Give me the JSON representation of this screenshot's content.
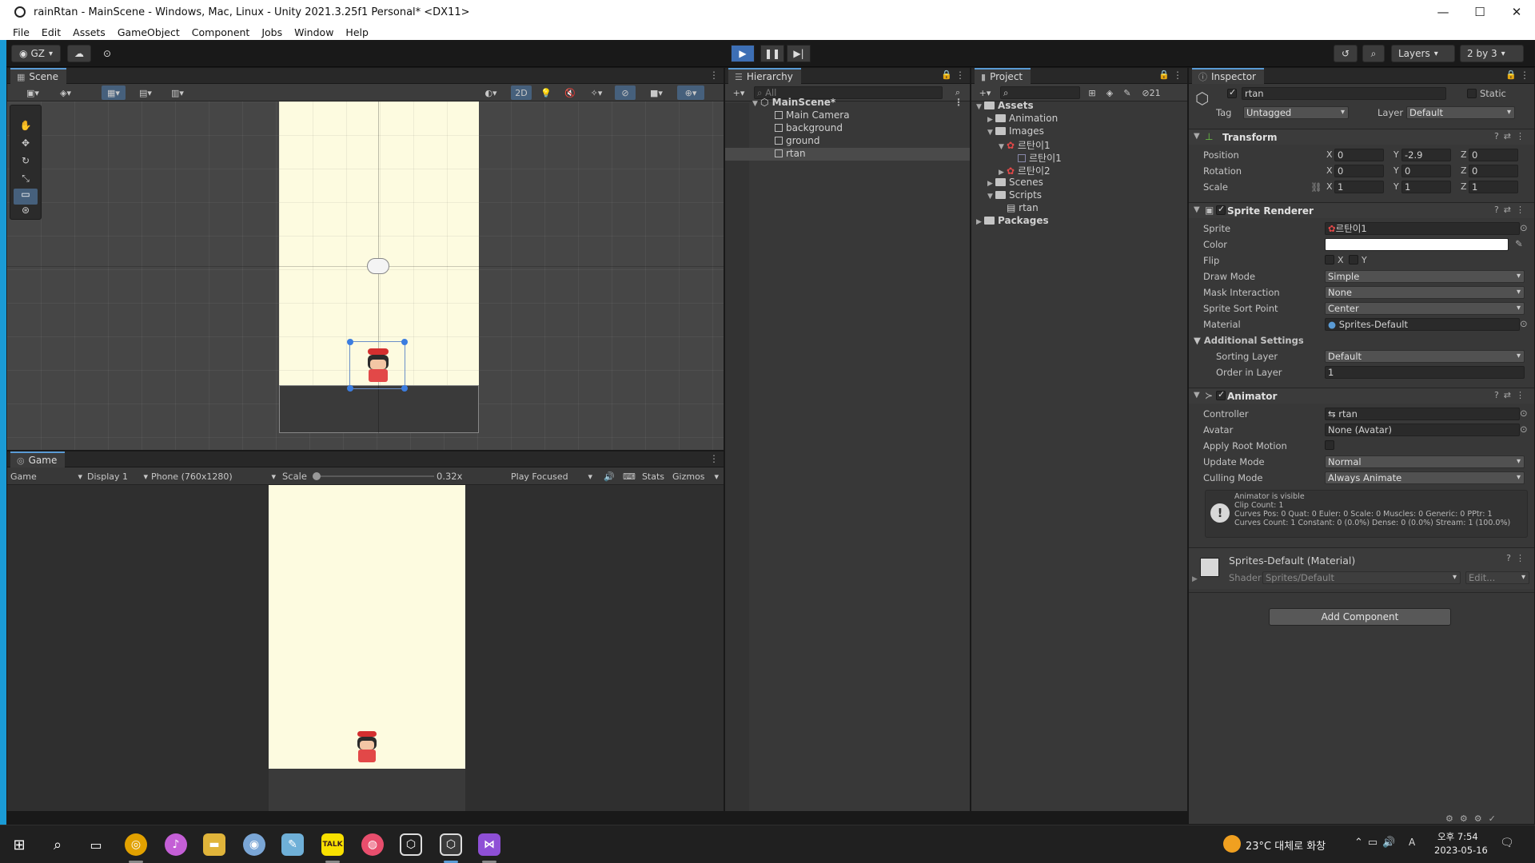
{
  "window": {
    "title": "rainRtan - MainScene - Windows, Mac, Linux - Unity 2021.3.25f1 Personal* <DX11>"
  },
  "menu": [
    "File",
    "Edit",
    "Assets",
    "GameObject",
    "Component",
    "Jobs",
    "Window",
    "Help"
  ],
  "toolbar": {
    "account": "GZ",
    "layers": "Layers",
    "layout": "2 by 3"
  },
  "scene": {
    "tab": "Scene",
    "mode_2d": "2D"
  },
  "game": {
    "tab": "Game",
    "view": "Game",
    "display": "Display 1",
    "resolution": "Phone (760x1280)",
    "scale_label": "Scale",
    "scale_value": "0.32x",
    "play_mode": "Play Focused",
    "stats": "Stats",
    "gizmos": "Gizmos"
  },
  "hierarchy": {
    "tab": "Hierarchy",
    "search_placeholder": "All",
    "scene_name": "MainScene*",
    "items": [
      "Main Camera",
      "background",
      "ground",
      "rtan"
    ]
  },
  "project": {
    "tab": "Project",
    "count": "21",
    "tree": {
      "assets": "Assets",
      "animation": "Animation",
      "images": "Images",
      "img1": "르탄이1",
      "img1_sub": "르탄이1",
      "img2": "르탄이2",
      "scenes": "Scenes",
      "scripts": "Scripts",
      "script_rtan": "rtan",
      "packages": "Packages"
    }
  },
  "inspector": {
    "tab": "Inspector",
    "object_name": "rtan",
    "static_label": "Static",
    "tag_label": "Tag",
    "tag_value": "Untagged",
    "layer_label": "Layer",
    "layer_value": "Default",
    "transform": {
      "title": "Transform",
      "position_label": "Position",
      "rotation_label": "Rotation",
      "scale_label": "Scale",
      "x": "X",
      "y": "Y",
      "z": "Z",
      "position": [
        "0",
        "-2.9",
        "0"
      ],
      "rotation": [
        "0",
        "0",
        "0"
      ],
      "scale": [
        "1",
        "1",
        "1"
      ]
    },
    "sprite_renderer": {
      "title": "Sprite Renderer",
      "sprite_label": "Sprite",
      "sprite": "르탄이1",
      "color_label": "Color",
      "color": "#ffffff",
      "flip_label": "Flip",
      "flip_x": "X",
      "flip_y": "Y",
      "draw_mode_label": "Draw Mode",
      "draw_mode": "Simple",
      "mask_label": "Mask Interaction",
      "mask": "None",
      "sort_point_label": "Sprite Sort Point",
      "sort_point": "Center",
      "material_label": "Material",
      "material": "Sprites-Default",
      "additional_label": "Additional Settings",
      "sorting_layer_label": "Sorting Layer",
      "sorting_layer": "Default",
      "order_label": "Order in Layer",
      "order": "1"
    },
    "animator": {
      "title": "Animator",
      "controller_label": "Controller",
      "controller": "rtan",
      "avatar_label": "Avatar",
      "avatar": "None (Avatar)",
      "root_motion_label": "Apply Root Motion",
      "update_mode_label": "Update Mode",
      "update_mode": "Normal",
      "culling_label": "Culling Mode",
      "culling": "Always Animate",
      "info": [
        "Animator is visible",
        "Clip Count: 1",
        "Curves Pos: 0 Quat: 0 Euler: 0 Scale: 0 Muscles: 0 Generic: 0 PPtr: 1",
        "Curves Count: 1 Constant: 0 (0.0%) Dense: 0 (0.0%) Stream: 1 (100.0%)"
      ]
    },
    "material": {
      "title": "Sprites-Default (Material)",
      "shader_label": "Shader",
      "shader": "Sprites/Default",
      "edit": "Edit..."
    },
    "add_component": "Add Component"
  },
  "taskbar": {
    "weather": "23°C  대체로 화창",
    "time": "오후 7:54",
    "date": "2023-05-16",
    "kakao": "TALK"
  }
}
